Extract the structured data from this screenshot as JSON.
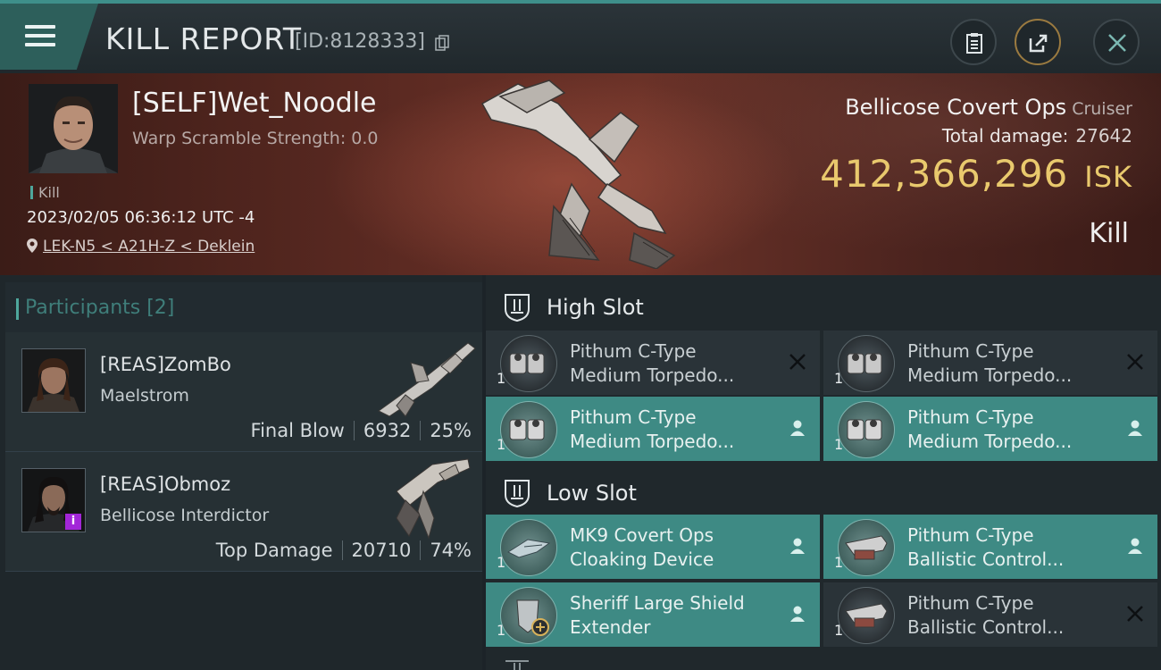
{
  "header": {
    "title": "KILL REPORT",
    "report_id": "[ID:8128333]",
    "buttons": [
      "clipboard",
      "share",
      "close"
    ]
  },
  "victim": {
    "name": "[SELF]Wet_Noodle",
    "subtitle": "Warp Scramble Strength: 0.0",
    "tag": "Kill",
    "datetime": "2023/02/05 06:36:12 UTC -4",
    "location": "LEK-N5 < A21H-Z < Deklein",
    "ship_name": "Bellicose Covert Ops",
    "ship_class": "Cruiser",
    "total_damage_label": "Total damage:",
    "total_damage": "27642",
    "isk_value": "412,366,296",
    "isk_unit": "ISK",
    "outcome": "Kill"
  },
  "participants": {
    "title": "Participants [2]",
    "items": [
      {
        "name": "[REAS]ZomBo",
        "ship": "Maelstrom",
        "role": "Final Blow",
        "damage": "6932",
        "percent": "25%"
      },
      {
        "name": "[REAS]Obmoz",
        "ship": "Bellicose Interdictor",
        "role": "Top Damage",
        "damage": "20710",
        "percent": "74%"
      }
    ]
  },
  "fitting": {
    "high_slot": {
      "title": "High Slot",
      "modules": [
        {
          "line1": "Pithum C-Type",
          "line2": "Medium Torpedo...",
          "qty": "1",
          "status": "destroyed"
        },
        {
          "line1": "Pithum C-Type",
          "line2": "Medium Torpedo...",
          "qty": "1",
          "status": "destroyed"
        },
        {
          "line1": "Pithum C-Type",
          "line2": "Medium Torpedo...",
          "qty": "1",
          "status": "dropped"
        },
        {
          "line1": "Pithum C-Type",
          "line2": "Medium Torpedo...",
          "qty": "1",
          "status": "dropped"
        }
      ]
    },
    "low_slot": {
      "title": "Low Slot",
      "modules": [
        {
          "line1": "MK9 Covert Ops",
          "line2": "Cloaking Device",
          "qty": "1",
          "status": "dropped"
        },
        {
          "line1": "Pithum C-Type",
          "line2": "Ballistic Control...",
          "qty": "1",
          "status": "dropped"
        },
        {
          "line1": "Sheriff Large Shield",
          "line2": "Extender",
          "qty": "1",
          "status": "dropped"
        },
        {
          "line1": "Pithum C-Type",
          "line2": "Ballistic Control...",
          "qty": "1",
          "status": "destroyed"
        }
      ]
    },
    "colors": {
      "accent": "#3e8a84",
      "isk": "#e9c96d",
      "banner": "#5c2a22"
    }
  }
}
